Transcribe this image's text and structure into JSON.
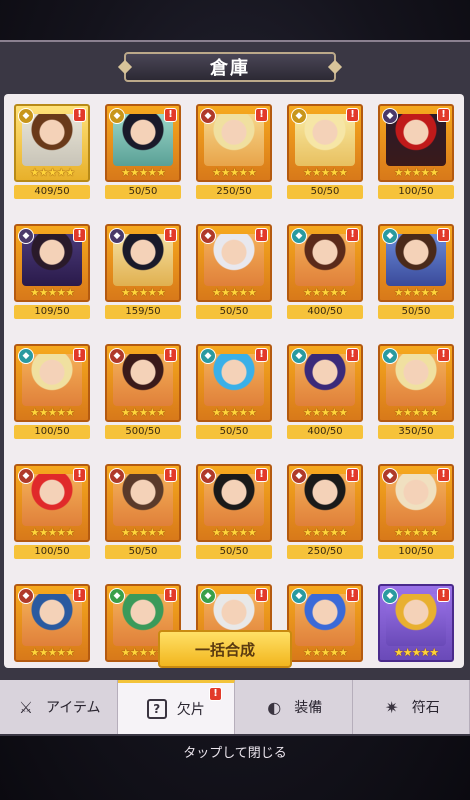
{
  "title": "倉庫",
  "items": [
    {
      "count": "409/50",
      "frame": "gold",
      "icon": "gold",
      "bg1": "#e8e4d6",
      "bg2": "#c8c4b8",
      "hair": "#6a3a1a"
    },
    {
      "count": "50/50",
      "frame": "orange",
      "icon": "gold",
      "bg1": "#9ad6c8",
      "bg2": "#5aa096",
      "hair": "#1a1a2a"
    },
    {
      "count": "250/50",
      "frame": "orange",
      "icon": "red",
      "bg1": "#f6d68a",
      "bg2": "#e8a44a",
      "hair": "#f0e0a0"
    },
    {
      "count": "50/50",
      "frame": "orange",
      "icon": "gold",
      "bg1": "#f8e8a0",
      "bg2": "#e8c060",
      "hair": "#f6e6a6"
    },
    {
      "count": "100/50",
      "frame": "orange",
      "icon": "purple",
      "bg1": "#2a1a2a",
      "bg2": "#3a1a1a",
      "hair": "#c01a1a"
    },
    {
      "count": "109/50",
      "frame": "orange",
      "icon": "purple",
      "bg1": "#4a3a7a",
      "bg2": "#2a1a4a",
      "hair": "#2a1a2a"
    },
    {
      "count": "159/50",
      "frame": "orange",
      "icon": "purple",
      "bg1": "#f6e0a0",
      "bg2": "#e0b050",
      "hair": "#1a1a2a"
    },
    {
      "count": "50/50",
      "frame": "orange",
      "icon": "red",
      "bg1": "#f4b058",
      "bg2": "#e0803a",
      "hair": "#e8e8ee"
    },
    {
      "count": "400/50",
      "frame": "orange",
      "icon": "teal",
      "bg1": "#f4b058",
      "bg2": "#e0803a",
      "hair": "#5a2a1a"
    },
    {
      "count": "50/50",
      "frame": "orange",
      "icon": "teal",
      "bg1": "#6a8ad8",
      "bg2": "#3a4a9a",
      "hair": "#4a2a1a"
    },
    {
      "count": "100/50",
      "frame": "orange",
      "icon": "teal",
      "bg1": "#f4b058",
      "bg2": "#e0803a",
      "hair": "#f0e0a0"
    },
    {
      "count": "500/50",
      "frame": "orange",
      "icon": "red",
      "bg1": "#f4b058",
      "bg2": "#e0803a",
      "hair": "#3a1a1a"
    },
    {
      "count": "50/50",
      "frame": "orange",
      "icon": "teal",
      "bg1": "#f4b058",
      "bg2": "#e0803a",
      "hair": "#3ab0e8"
    },
    {
      "count": "400/50",
      "frame": "orange",
      "icon": "teal",
      "bg1": "#f4b058",
      "bg2": "#e0803a",
      "hair": "#3a2a7a"
    },
    {
      "count": "350/50",
      "frame": "orange",
      "icon": "teal",
      "bg1": "#f4b058",
      "bg2": "#e0803a",
      "hair": "#f0e0a0"
    },
    {
      "count": "100/50",
      "frame": "orange",
      "icon": "red",
      "bg1": "#f4b058",
      "bg2": "#e0803a",
      "hair": "#e02a2a"
    },
    {
      "count": "50/50",
      "frame": "orange",
      "icon": "red",
      "bg1": "#f4b058",
      "bg2": "#e0803a",
      "hair": "#5a3a2a"
    },
    {
      "count": "50/50",
      "frame": "orange",
      "icon": "red",
      "bg1": "#f4b058",
      "bg2": "#e0803a",
      "hair": "#1a1a1a"
    },
    {
      "count": "250/50",
      "frame": "orange",
      "icon": "red",
      "bg1": "#f4b058",
      "bg2": "#e0803a",
      "hair": "#1a1a1a"
    },
    {
      "count": "100/50",
      "frame": "orange",
      "icon": "red",
      "bg1": "#f4b058",
      "bg2": "#e0803a",
      "hair": "#f0e0c0"
    },
    {
      "count": "",
      "frame": "orange",
      "icon": "red",
      "bg1": "#f4b058",
      "bg2": "#e0803a",
      "hair": "#2a5aa0"
    },
    {
      "count": "",
      "frame": "orange",
      "icon": "green",
      "bg1": "#f4b058",
      "bg2": "#e0803a",
      "hair": "#3a9a5a"
    },
    {
      "count": "",
      "frame": "orange",
      "icon": "green",
      "bg1": "#f4b058",
      "bg2": "#e0803a",
      "hair": "#e8e8e8"
    },
    {
      "count": "",
      "frame": "orange",
      "icon": "teal",
      "bg1": "#f4b058",
      "bg2": "#e0803a",
      "hair": "#3a6ad8"
    },
    {
      "count": "",
      "frame": "purple",
      "icon": "teal",
      "bg1": "#9a72e8",
      "bg2": "#6a4ab8",
      "hair": "#e8b030"
    }
  ],
  "stars": "★★★★★",
  "alert_mark": "!",
  "combine_button": "一括合成",
  "tabs": [
    {
      "label": "アイテム",
      "icon": "scroll-icon",
      "glyph": "⚔",
      "active": false,
      "alert": false
    },
    {
      "label": "欠片",
      "icon": "question-box-icon",
      "glyph": "?",
      "active": true,
      "alert": true
    },
    {
      "label": "装備",
      "icon": "shield-icon",
      "glyph": "◐",
      "active": false,
      "alert": false
    },
    {
      "label": "符石",
      "icon": "rune-icon",
      "glyph": "✷",
      "active": false,
      "alert": false
    }
  ],
  "close_hint": "タップして閉じる"
}
